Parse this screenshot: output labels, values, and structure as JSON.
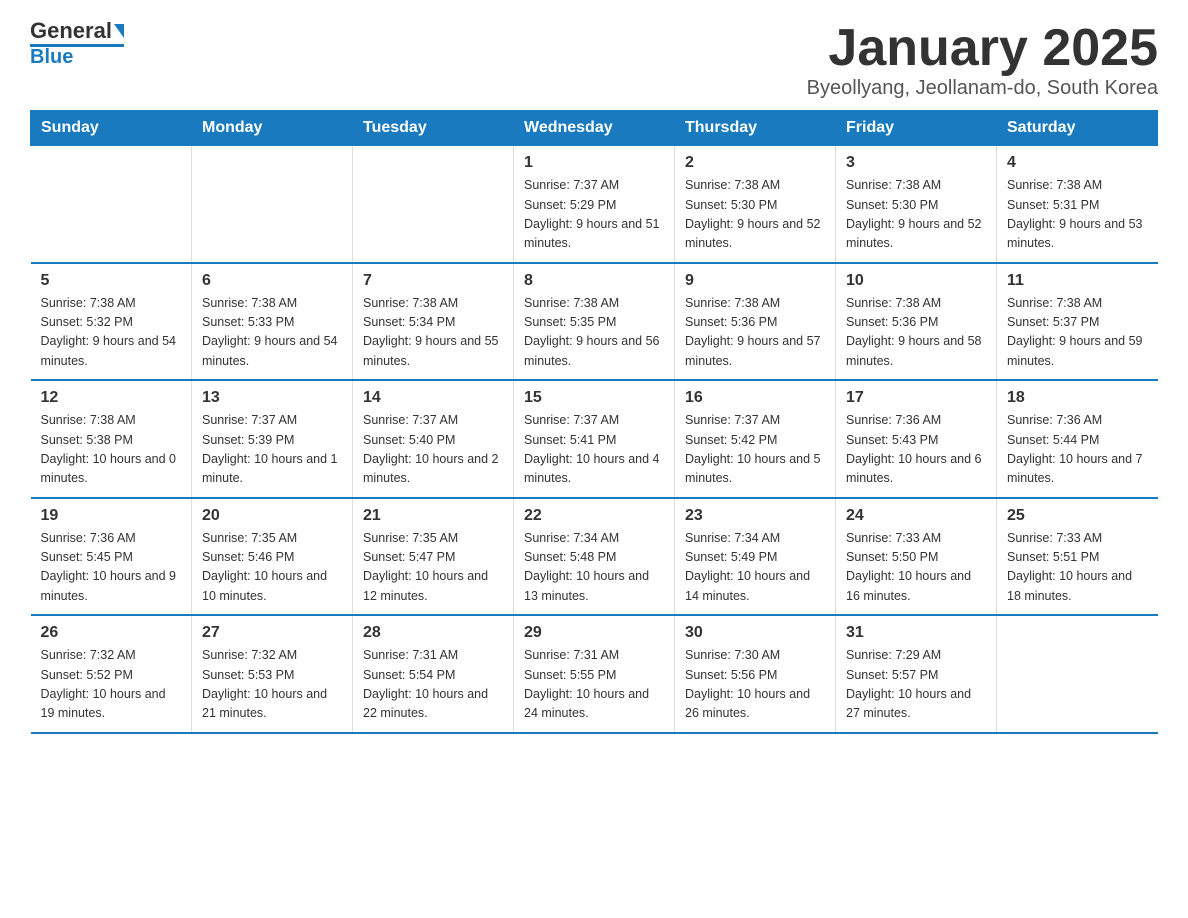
{
  "logo": {
    "text_general": "General",
    "text_blue": "Blue"
  },
  "title": "January 2025",
  "location": "Byeollyang, Jeollanam-do, South Korea",
  "header_color": "#1a7abf",
  "days_of_week": [
    "Sunday",
    "Monday",
    "Tuesday",
    "Wednesday",
    "Thursday",
    "Friday",
    "Saturday"
  ],
  "weeks": [
    [
      {
        "day": "",
        "info": ""
      },
      {
        "day": "",
        "info": ""
      },
      {
        "day": "",
        "info": ""
      },
      {
        "day": "1",
        "info": "Sunrise: 7:37 AM\nSunset: 5:29 PM\nDaylight: 9 hours and 51 minutes."
      },
      {
        "day": "2",
        "info": "Sunrise: 7:38 AM\nSunset: 5:30 PM\nDaylight: 9 hours and 52 minutes."
      },
      {
        "day": "3",
        "info": "Sunrise: 7:38 AM\nSunset: 5:30 PM\nDaylight: 9 hours and 52 minutes."
      },
      {
        "day": "4",
        "info": "Sunrise: 7:38 AM\nSunset: 5:31 PM\nDaylight: 9 hours and 53 minutes."
      }
    ],
    [
      {
        "day": "5",
        "info": "Sunrise: 7:38 AM\nSunset: 5:32 PM\nDaylight: 9 hours and 54 minutes."
      },
      {
        "day": "6",
        "info": "Sunrise: 7:38 AM\nSunset: 5:33 PM\nDaylight: 9 hours and 54 minutes."
      },
      {
        "day": "7",
        "info": "Sunrise: 7:38 AM\nSunset: 5:34 PM\nDaylight: 9 hours and 55 minutes."
      },
      {
        "day": "8",
        "info": "Sunrise: 7:38 AM\nSunset: 5:35 PM\nDaylight: 9 hours and 56 minutes."
      },
      {
        "day": "9",
        "info": "Sunrise: 7:38 AM\nSunset: 5:36 PM\nDaylight: 9 hours and 57 minutes."
      },
      {
        "day": "10",
        "info": "Sunrise: 7:38 AM\nSunset: 5:36 PM\nDaylight: 9 hours and 58 minutes."
      },
      {
        "day": "11",
        "info": "Sunrise: 7:38 AM\nSunset: 5:37 PM\nDaylight: 9 hours and 59 minutes."
      }
    ],
    [
      {
        "day": "12",
        "info": "Sunrise: 7:38 AM\nSunset: 5:38 PM\nDaylight: 10 hours and 0 minutes."
      },
      {
        "day": "13",
        "info": "Sunrise: 7:37 AM\nSunset: 5:39 PM\nDaylight: 10 hours and 1 minute."
      },
      {
        "day": "14",
        "info": "Sunrise: 7:37 AM\nSunset: 5:40 PM\nDaylight: 10 hours and 2 minutes."
      },
      {
        "day": "15",
        "info": "Sunrise: 7:37 AM\nSunset: 5:41 PM\nDaylight: 10 hours and 4 minutes."
      },
      {
        "day": "16",
        "info": "Sunrise: 7:37 AM\nSunset: 5:42 PM\nDaylight: 10 hours and 5 minutes."
      },
      {
        "day": "17",
        "info": "Sunrise: 7:36 AM\nSunset: 5:43 PM\nDaylight: 10 hours and 6 minutes."
      },
      {
        "day": "18",
        "info": "Sunrise: 7:36 AM\nSunset: 5:44 PM\nDaylight: 10 hours and 7 minutes."
      }
    ],
    [
      {
        "day": "19",
        "info": "Sunrise: 7:36 AM\nSunset: 5:45 PM\nDaylight: 10 hours and 9 minutes."
      },
      {
        "day": "20",
        "info": "Sunrise: 7:35 AM\nSunset: 5:46 PM\nDaylight: 10 hours and 10 minutes."
      },
      {
        "day": "21",
        "info": "Sunrise: 7:35 AM\nSunset: 5:47 PM\nDaylight: 10 hours and 12 minutes."
      },
      {
        "day": "22",
        "info": "Sunrise: 7:34 AM\nSunset: 5:48 PM\nDaylight: 10 hours and 13 minutes."
      },
      {
        "day": "23",
        "info": "Sunrise: 7:34 AM\nSunset: 5:49 PM\nDaylight: 10 hours and 14 minutes."
      },
      {
        "day": "24",
        "info": "Sunrise: 7:33 AM\nSunset: 5:50 PM\nDaylight: 10 hours and 16 minutes."
      },
      {
        "day": "25",
        "info": "Sunrise: 7:33 AM\nSunset: 5:51 PM\nDaylight: 10 hours and 18 minutes."
      }
    ],
    [
      {
        "day": "26",
        "info": "Sunrise: 7:32 AM\nSunset: 5:52 PM\nDaylight: 10 hours and 19 minutes."
      },
      {
        "day": "27",
        "info": "Sunrise: 7:32 AM\nSunset: 5:53 PM\nDaylight: 10 hours and 21 minutes."
      },
      {
        "day": "28",
        "info": "Sunrise: 7:31 AM\nSunset: 5:54 PM\nDaylight: 10 hours and 22 minutes."
      },
      {
        "day": "29",
        "info": "Sunrise: 7:31 AM\nSunset: 5:55 PM\nDaylight: 10 hours and 24 minutes."
      },
      {
        "day": "30",
        "info": "Sunrise: 7:30 AM\nSunset: 5:56 PM\nDaylight: 10 hours and 26 minutes."
      },
      {
        "day": "31",
        "info": "Sunrise: 7:29 AM\nSunset: 5:57 PM\nDaylight: 10 hours and 27 minutes."
      },
      {
        "day": "",
        "info": ""
      }
    ]
  ]
}
